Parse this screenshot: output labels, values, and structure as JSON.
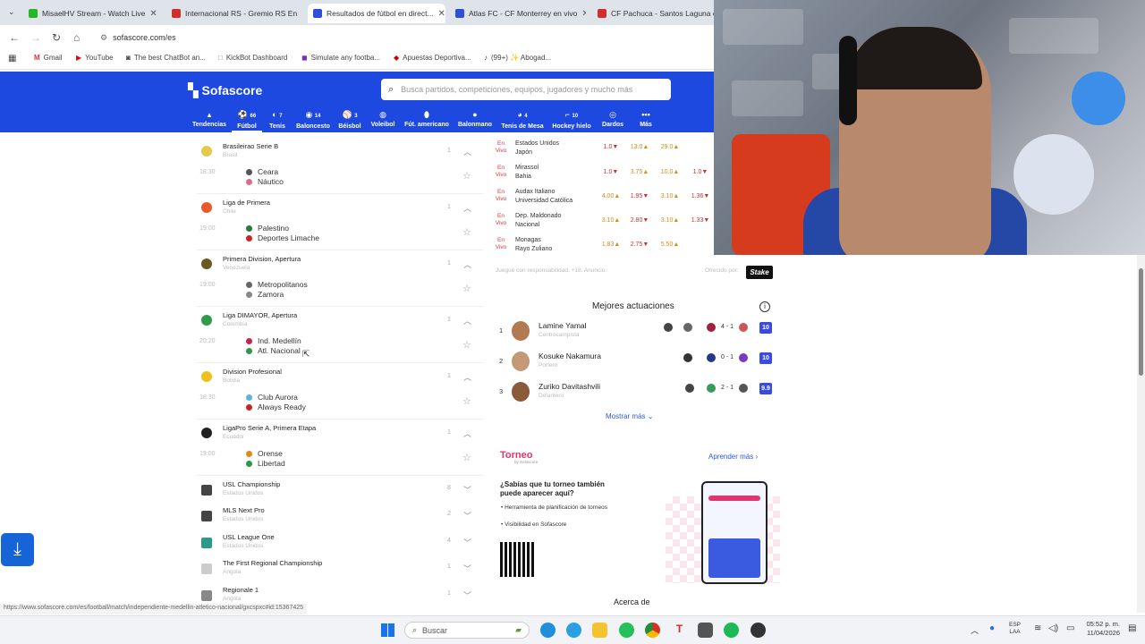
{
  "browser": {
    "tabs": [
      {
        "title": "MisaelHV Stream - Watch Live",
        "color": "#27b52a"
      },
      {
        "title": "Internacional RS - Gremio RS En",
        "color": "#d0302b"
      },
      {
        "title": "Resultados de fútbol en direct...",
        "color": "#2f4fd8"
      },
      {
        "title": "Atlas FC - CF Monterrey en vivo",
        "color": "#2f4fd8"
      },
      {
        "title": "CF Pachuca - Santos Laguna en",
        "color": "#d0302b"
      }
    ],
    "url": "sofascore.com/es",
    "bookmarks": [
      "Gmail",
      "YouTube",
      "The best ChatBot an...",
      "KickBot Dashboard",
      "Simulate any footba...",
      "Apuestas Deportiva...",
      "(99+) ✨ Abogad..."
    ]
  },
  "header": {
    "logo": "Sofascore",
    "search_placeholder": "Busca partidos, competiciones, equipos, jugadores y mucho más"
  },
  "sports": [
    {
      "label": "Tendencias",
      "count": ""
    },
    {
      "label": "Fútbol",
      "count": "66"
    },
    {
      "label": "Tenis",
      "count": "7"
    },
    {
      "label": "Baloncesto",
      "count": "14"
    },
    {
      "label": "Béisbol",
      "count": "3"
    },
    {
      "label": "Voleibol",
      "count": ""
    },
    {
      "label": "Fút. americano",
      "count": ""
    },
    {
      "label": "Balonmano",
      "count": ""
    },
    {
      "label": "Tenis de Mesa",
      "count": "4"
    },
    {
      "label": "Hockey hielo",
      "count": "10"
    },
    {
      "label": "Dardos",
      "count": ""
    },
    {
      "label": "Más",
      "count": ""
    }
  ],
  "leagues": [
    {
      "name": "Brasileirao Serie B",
      "country": "Brasil",
      "count": "1",
      "time": "18:30",
      "home": "Ceara",
      "away": "Náutico"
    },
    {
      "name": "Liga de Primera",
      "country": "Chile",
      "count": "1",
      "time": "19:00",
      "home": "Palestino",
      "away": "Deportes Limache"
    },
    {
      "name": "Primera Division, Apertura",
      "country": "Venezuela",
      "count": "1",
      "time": "19:00",
      "home": "Metropolitanos",
      "away": "Zamora"
    },
    {
      "name": "Liga DIMAYOR, Apertura",
      "country": "Colombia",
      "count": "1",
      "time": "20:20",
      "home": "Ind. Medellín",
      "away": "Atl. Nacional"
    },
    {
      "name": "Division Profesional",
      "country": "Bolivia",
      "count": "1",
      "time": "18:30",
      "home": "Club Aurora",
      "away": "Always Ready"
    },
    {
      "name": "LigaPro Serie A, Primera Etapa",
      "country": "Ecuador",
      "count": "1",
      "time": "19:00",
      "home": "Orense",
      "away": "Libertad"
    }
  ],
  "collapsed_leagues": [
    {
      "name": "USL Championship",
      "country": "Estados Unidos",
      "count": "8"
    },
    {
      "name": "MLS Next Pro",
      "country": "Estados Unidos",
      "count": "2"
    },
    {
      "name": "USL League One",
      "country": "Estados Unidos",
      "count": "4"
    },
    {
      "name": "The First Regional Championship",
      "country": "Angola",
      "count": "1"
    },
    {
      "name": "Regionale 1",
      "country": "Angola",
      "count": "1"
    }
  ],
  "live_odds": [
    {
      "live": "En Vivo",
      "home": "Estados Unidos",
      "away": "Japón",
      "odds": [
        "1.0▼",
        "13.0▲",
        "29.0▲"
      ]
    },
    {
      "live": "En Vivo",
      "home": "Mirassol",
      "away": "Bahia",
      "odds": [
        "1.0▼",
        "3.75▲",
        "10.0▲",
        "1.0▼"
      ]
    },
    {
      "live": "En Vivo",
      "home": "Audax Italiano",
      "away": "Universidad Católica",
      "odds": [
        "4.00▲",
        "1.95▼",
        "3.10▲",
        "1.36▼"
      ]
    },
    {
      "live": "En Vivo",
      "home": "Dep. Maldonado",
      "away": "Nacional",
      "odds": [
        "3.10▲",
        "2.80▼",
        "3.10▲",
        "1.33▼"
      ]
    },
    {
      "live": "En Vivo",
      "home": "Monagas",
      "away": "Rayo Zuliano",
      "odds": [
        "1.83▲",
        "2.75▼",
        "5.50▲"
      ]
    }
  ],
  "disclaimer": "Juegue con responsabilidad. +18. Anuncio.",
  "offered_by": "Ofrecido por:",
  "sponsor": "Stake",
  "best": {
    "title": "Mejores actuaciones",
    "players": [
      {
        "rank": "1",
        "name": "Lamine Yamal",
        "position": "Centrocampista",
        "score": "4 - 1",
        "rating": "10"
      },
      {
        "rank": "2",
        "name": "Kosuke Nakamura",
        "position": "Portero",
        "score": "0 - 1",
        "rating": "10"
      },
      {
        "rank": "3",
        "name": "Zuriko Davitashvili",
        "position": "Delantero",
        "score": "2 - 1",
        "rating": "9.9"
      }
    ],
    "more": "Mostrar más"
  },
  "torneo": {
    "logo": "Torneo",
    "by": "by Sofascore",
    "learn": "Aprender más",
    "question": "¿Sabías que tu torneo también puede aparecer aquí?",
    "bullets": [
      "Herramienta de planificación de torneos",
      "Visibilidad en Sofascore"
    ]
  },
  "about": "Acerca de",
  "status_url": "https://www.sofascore.com/es/football/match/independiente-medellin-atletico-nacional/gxcspxc#id:15367425",
  "taskbar": {
    "search": "Buscar",
    "lang1": "ESP",
    "lang2": "LAA",
    "time": "05:52 p. m.",
    "date": "11/04/2026"
  }
}
